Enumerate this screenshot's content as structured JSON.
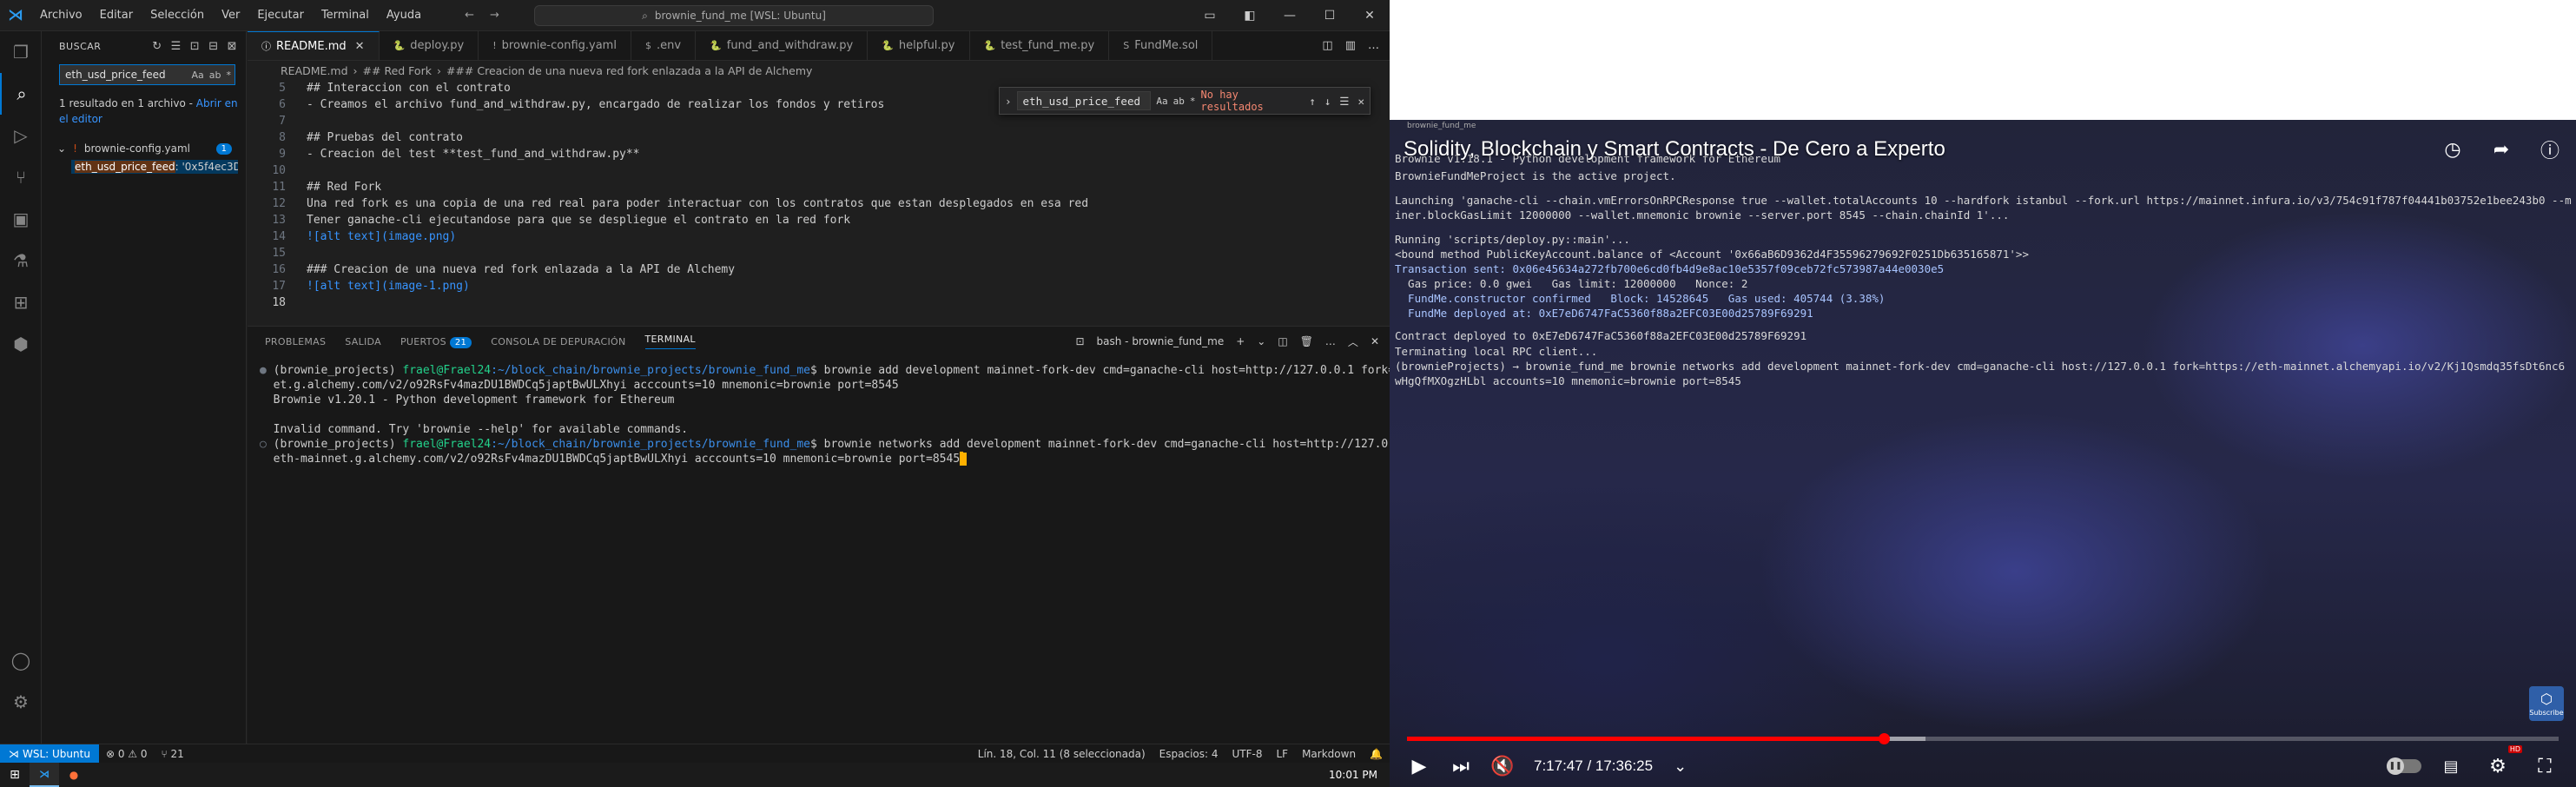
{
  "vscode": {
    "menu": [
      "Archivo",
      "Editar",
      "Selección",
      "Ver",
      "Ejecutar",
      "Terminal",
      "Ayuda"
    ],
    "command_center": "brownie_fund_me [WSL: Ubuntu]",
    "sidebar": {
      "header": "BUSCAR",
      "search_value": "eth_usd_price_feed",
      "search_options": [
        "Aa",
        "ab",
        "*"
      ],
      "result_text": "1 resultado en 1 archivo - ",
      "result_link": "Abrir en el editor",
      "file_name": "brownie-config.yaml",
      "file_badge": "1",
      "match_highlight": "eth_usd_price_feed",
      "match_rest": ": '0x5f4ec3Df..."
    },
    "tabs": [
      {
        "label": "README.md",
        "icon": "ⓘ",
        "active": true
      },
      {
        "label": "deploy.py",
        "icon": "🐍",
        "active": false
      },
      {
        "label": "brownie-config.yaml",
        "icon": "!",
        "active": false
      },
      {
        "label": ".env",
        "icon": "$",
        "active": false
      },
      {
        "label": "fund_and_withdraw.py",
        "icon": "🐍",
        "active": false
      },
      {
        "label": "helpful.py",
        "icon": "🐍",
        "active": false
      },
      {
        "label": "test_fund_me.py",
        "icon": "🐍",
        "active": false
      },
      {
        "label": "FundMe.sol",
        "icon": "S",
        "active": false
      }
    ],
    "breadcrumb": [
      "README.md",
      "## Red Fork",
      "### Creacion de una nueva red fork enlazada a la API de Alchemy"
    ],
    "find_widget": {
      "value": "eth_usd_price_feed",
      "options": [
        "Aa",
        "ab",
        "*"
      ],
      "result": "No hay resultados"
    },
    "code_lines": [
      {
        "n": "5",
        "t": "## Interaccion con el contrato"
      },
      {
        "n": "6",
        "t": "- Creamos el archivo fund_and_withdraw.py, encargado de realizar los fondos y retiros"
      },
      {
        "n": "7",
        "t": ""
      },
      {
        "n": "8",
        "t": "## Pruebas del contrato"
      },
      {
        "n": "9",
        "t": "- Creacion del test **test_fund_and_withdraw.py**"
      },
      {
        "n": "10",
        "t": ""
      },
      {
        "n": "11",
        "t": "## Red Fork"
      },
      {
        "n": "12",
        "t": "Una red fork es una copia de una red real para poder interactuar con los contratos que estan desplegados en esa red"
      },
      {
        "n": "13",
        "t": "Tener ganache-cli ejecutandose para que se despliegue el contrato en la red fork"
      },
      {
        "n": "14",
        "t": "![alt text](image.png)"
      },
      {
        "n": "15",
        "t": ""
      },
      {
        "n": "16",
        "t": "### Creacion de una nueva red fork enlazada a la API de Alchemy"
      },
      {
        "n": "17",
        "t": "![alt text](image-1.png)"
      },
      {
        "n": "18",
        "t": ""
      }
    ],
    "panel_tabs": [
      "PROBLEMAS",
      "SALIDA",
      "PUERTOS",
      "CONSOLA DE DEPURACIÓN",
      "TERMINAL"
    ],
    "ports_count": "21",
    "terminal_name": "bash - brownie_fund_me",
    "terminal": {
      "prompt_env": "(brownie_projects) ",
      "prompt_user": "frael@Frael24",
      "prompt_path": ":~/block_chain/brownie_projects/brownie_fund_me",
      "cmd1": "$ brownie add development mainnet-fork-dev cmd=ganache-cli host=http://127.0.0.1 fork=https://eth-mainn",
      "cmd1b": "et.g.alchemy.com/v2/o92RsFv4mazDU1BWDCq5japtBwULXhyi acccounts=10 mnemonic=brownie port=8545",
      "out1": "Brownie v1.20.1 - Python development framework for Ethereum",
      "out2": "Invalid command. Try 'brownie --help' for available commands.",
      "cmd2": "$ brownie networks add development mainnet-fork-dev cmd=ganache-cli host=http://127.0.0.1 fork=https://",
      "cmd2b": "eth-mainnet.g.alchemy.com/v2/o92RsFv4mazDU1BWDCq5japtBwULXhyi acccounts=10 mnemonic=brownie port=8545"
    },
    "status": {
      "remote": "WSL: Ubuntu",
      "problems": "⊗ 0 ⚠ 0",
      "ports": "⑂ 21",
      "position": "Lín. 18, Col. 11 (8 seleccionada)",
      "spaces": "Espacios: 4",
      "encoding": "UTF-8",
      "eol": "LF",
      "language": "Markdown"
    },
    "clock": "10:01 PM"
  },
  "video": {
    "title": "Solidity, Blockchain y Smart Contracts - De Cero a Experto",
    "mini_tab": "brownie_fund_me",
    "terminal_lines": [
      "Brownie v1.18.1 - Python development framework for Ethereum",
      "BrownieFundMeProject is the active project.",
      "Launching 'ganache-cli --chain.vmErrorsOnRPCResponse true --wallet.totalAccounts 10 --hardfork istanbul --fork.url https://mainnet.infura.io/v3/754c91f787f04441b03752e1bee243b0 --m",
      "iner.blockGasLimit 12000000 --wallet.mnemonic brownie --server.port 8545 --chain.chainId 1'...",
      "Running 'scripts/deploy.py::main'...",
      "<bound method PublicKeyAccount.balance of <Account '0x66aB6D9362d4F35596279692F0251Db635165871'>>",
      "Transaction sent: 0x06e45634a272fb700e6cd0fb4d9e8ac10e5357f09ceb72fc573987a44e0030e5",
      "  Gas price: 0.0 gwei   Gas limit: 12000000   Nonce: 2",
      "  FundMe.constructor confirmed   Block: 14528645   Gas used: 405744 (3.38%)",
      "  FundMe deployed at: 0xE7eD6747FaC5360f88a2EFC03E00d25789F69291",
      "Contract deployed to 0xE7eD6747FaC5360f88a2EFC03E00d25789F69291",
      "Terminating local RPC client...",
      "(brownieProjects) → brownie_fund_me brownie networks add development mainnet-fork-dev cmd=ganache-cli host://127.0.0.1 fork=https://eth-mainnet.alchemyapi.io/v2/Kj1Qsmdq35fsDt6nc6",
      "wHgQfMXOgzHLbl accounts=10 mnemonic=brownie port=8545"
    ],
    "time": "7:17:47 / 17:36:25",
    "progress": 0.414,
    "buffered": 0.45,
    "subscribe_label": "Subscribe",
    "hd_badge": "HD"
  }
}
